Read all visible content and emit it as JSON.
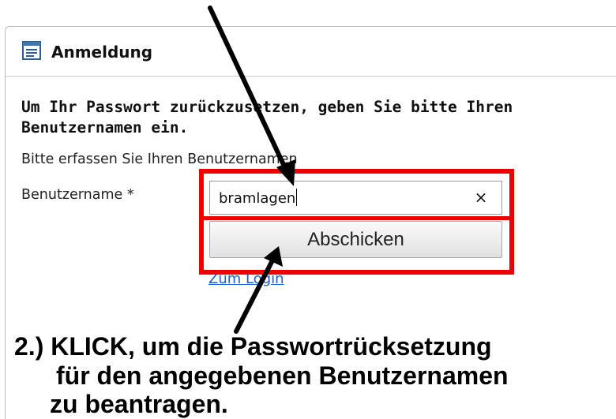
{
  "dialog": {
    "title": "Anmeldung",
    "title_icon": "window-form-icon",
    "heading": "Um Ihr Passwort zurückzusetzen, geben Sie bitte Ihren Benutzernamen ein.",
    "instruction": "Bitte erfassen Sie Ihren Benutzernamen",
    "username_label": "Benutzername *",
    "username_value": "bramlagen",
    "clear_label": "×",
    "submit_label": "Abschicken",
    "login_link": "Zum Login"
  },
  "annotation": {
    "line1": "2.) KLICK, um die Passwortrücksetzung",
    "line2": "für den angegebenen Benutzernamen",
    "line3": "zu beantragen."
  },
  "colors": {
    "highlight": "#ee0000",
    "link": "#1a5fd6",
    "arrow": "#000000"
  }
}
